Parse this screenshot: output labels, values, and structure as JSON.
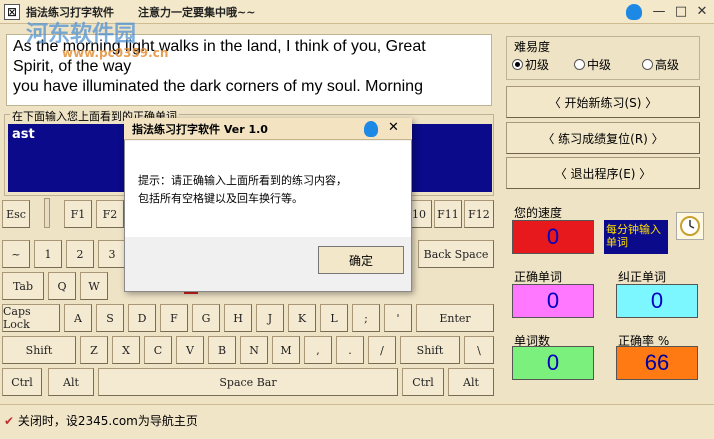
{
  "window": {
    "icon_glyph": "⊠",
    "title": "指法练习打字软件",
    "motto": "注意力一定要集中哦~~",
    "minimize": "—",
    "maximize": "□",
    "close": "✕",
    "watermark": "河东软件园",
    "watermark_url": "www.pc0359.cn"
  },
  "practice": {
    "lines": [
      "As the morning light walks in the land, I think of you, Great",
      "Spirit, of the way",
      "you have illuminated the dark corners of my soul. Morning"
    ]
  },
  "input": {
    "label": "在下面输入您上面看到的正确单词",
    "value": "ast"
  },
  "keyboard": {
    "row1": [
      "Esc",
      "F1",
      "F2",
      "10",
      "F11",
      "F12"
    ],
    "row2": [
      "~",
      "1",
      "2",
      "3",
      "Back Space"
    ],
    "row3": [
      "Tab",
      "Q",
      "W"
    ],
    "row4": [
      "Caps Lock",
      "A",
      "S",
      "D",
      "F",
      "G",
      "H",
      "J",
      "K",
      "L",
      ";",
      "'",
      "Enter"
    ],
    "row5": [
      "Shift",
      "Z",
      "X",
      "C",
      "V",
      "B",
      "N",
      "M",
      ",",
      ".",
      "/",
      "Shift",
      "\\"
    ],
    "row6": [
      "Ctrl",
      "Alt",
      "Space Bar",
      "Ctrl",
      "Alt"
    ]
  },
  "difficulty": {
    "label": "难易度",
    "options": [
      "初级",
      "中级",
      "高级"
    ],
    "selected": "初级"
  },
  "actions": {
    "start": "〈   开始新练习(S)   〉",
    "reset": "〈   练习成绩复位(R)   〉",
    "exit": "〈   退出程序(E)   〉"
  },
  "stats": {
    "speed_label": "您的速度",
    "speed_value": "0",
    "speed_unit": "每分钟输入单词",
    "correct_label": "正确单词",
    "correct_value": "0",
    "fixed_label": "纠正单词",
    "fixed_value": "0",
    "words_label": "单词数",
    "words_value": "0",
    "accuracy_label": "正确率 %",
    "accuracy_value": "66"
  },
  "status": {
    "text": "关闭时，设2345.com为导航主页"
  },
  "dialog": {
    "title": "指法练习打字软件 Ver 1.0",
    "close": "✕",
    "message_line1": "提示：请正确输入上面所看到的练习内容，",
    "message_line2": "包括所有空格键以及回车换行等。",
    "ok": "确定"
  },
  "colors": {
    "speed_box": "#e8191c",
    "speed_unit_box": "#0a0a8a",
    "correct_box": "#ff78ff",
    "fixed_box": "#7cf7ff",
    "words_box": "#7cf07c",
    "accuracy_box": "#ff7a12",
    "input_bg": "#0a0a8a"
  }
}
